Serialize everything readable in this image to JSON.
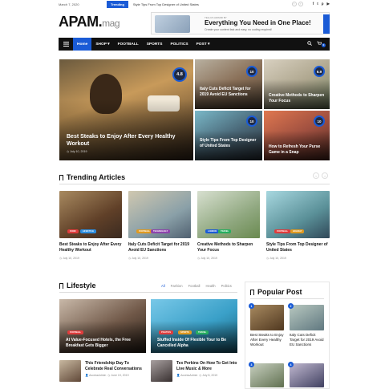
{
  "topbar": {
    "date": "March 7, 2020",
    "trending_label": "Trending",
    "trending_text": "Style Tips From Top Designer of United States",
    "prev": "‹",
    "next": "›",
    "social": [
      "f",
      "t",
      "p",
      "▶"
    ]
  },
  "header": {
    "logo_main": "APAM.",
    "logo_sub": "mag",
    "ad_small": "TELLUS AWARD BY",
    "ad_big": "Everything You Need in One Place!",
    "ad_sub": "Create your content fast and easy, no coding required!"
  },
  "nav": {
    "items": [
      {
        "label": "Home"
      },
      {
        "label": "SHOP ▾"
      },
      {
        "label": "FOOTBALL"
      },
      {
        "label": "SPORTS"
      },
      {
        "label": "POLITICS"
      },
      {
        "label": "POST ▾"
      }
    ],
    "cart_count": "0"
  },
  "hero": {
    "main": {
      "title": "Best Steaks to Enjoy After Every Healthy Workout",
      "date": "July 10, 2019",
      "score": "4.8"
    },
    "tiles": [
      {
        "title": "Italy Cuts Deficit Target for 2019 Avoid EU Sanctions",
        "score": "10"
      },
      {
        "title": "Creative Methods to Sharpen Your Focus",
        "score": "6.9"
      },
      {
        "title": "Style Tips From Top Designer of United States",
        "score": "10"
      },
      {
        "title": "How to Refresh Your Purse Game in a Snap",
        "score": "10"
      }
    ]
  },
  "trending": {
    "title": "Trending Articles",
    "prev": "‹",
    "next": "›",
    "cards": [
      {
        "title": "Best Steaks to Enjoy After Every Healthy Workout",
        "date": "July 10, 2019",
        "tags": [
          "FOOD",
          "LIFESTYLE"
        ]
      },
      {
        "title": "Italy Cuts Deficit Target for 2019 Avoid EU Sanctions",
        "date": "July 10, 2019",
        "tags": [
          "FOOTBALL",
          "TECHNOLOGY"
        ]
      },
      {
        "title": "Creative Methods to Sharpen Your Focus",
        "date": "July 10, 2019",
        "tags": [
          "LONDON",
          "TRAVEL"
        ]
      },
      {
        "title": "Style Tips From Top Designer of United States",
        "date": "July 10, 2019",
        "tags": [
          "FOOTBALL",
          "HOLIDAY"
        ]
      }
    ]
  },
  "lifestyle": {
    "title": "Lifestyle",
    "filters": [
      "All",
      "Fashion",
      "Football",
      "Health",
      "Politics"
    ],
    "big_cards": [
      {
        "title": "At Value-Focused Hotels, the Free Breakfast Gets Bigger",
        "tag": "FOOTBALL"
      },
      {
        "title": "Stuffed Inside Of Flexible Tour to Be Cancelled Alpha",
        "tags": [
          "POLITICS",
          "SPORTS",
          "TRAVEL"
        ]
      }
    ],
    "small_cards": [
      {
        "title": "This Friendship Day To Celebrate Real Conversations",
        "author": "AccessAdmin",
        "date": "June 19, 2019"
      },
      {
        "title": "Tex Perkins On How To Get Into Live Music & More",
        "author": "AccessAdmin",
        "date": "July 8, 2019"
      }
    ]
  },
  "popular": {
    "title": "Popular Post",
    "items": [
      {
        "num": "1",
        "title": "Best Steaks to Enjoy After Every Healthy Workout"
      },
      {
        "num": "2",
        "title": "Italy Cuts Deficit Target for 2019 Avoid EU Sanctions"
      },
      {
        "num": "3",
        "title": ""
      },
      {
        "num": "4",
        "title": ""
      }
    ]
  },
  "colors": {
    "accent": "#1a5bd6",
    "dark": "#111111"
  }
}
